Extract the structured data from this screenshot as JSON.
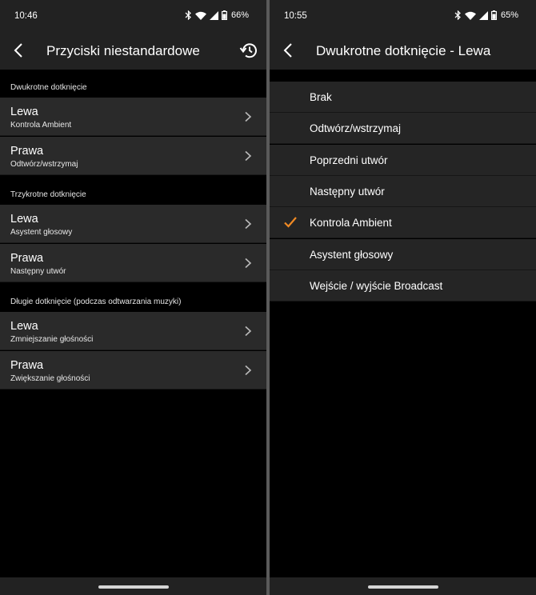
{
  "left": {
    "status": {
      "time": "10:46",
      "battery": "66%"
    },
    "title": "Przyciski niestandardowe",
    "sections": [
      {
        "header": "Dwukrotne dotknięcie",
        "items": [
          {
            "label": "Lewa",
            "value": "Kontrola Ambient"
          },
          {
            "label": "Prawa",
            "value": "Odtwórz/wstrzymaj"
          }
        ]
      },
      {
        "header": "Trzykrotne dotknięcie",
        "items": [
          {
            "label": "Lewa",
            "value": "Asystent głosowy"
          },
          {
            "label": "Prawa",
            "value": "Następny utwór"
          }
        ]
      },
      {
        "header": "Długie dotknięcie (podczas odtwarzania muzyki)",
        "items": [
          {
            "label": "Lewa",
            "value": "Zmniejszanie głośności"
          },
          {
            "label": "Prawa",
            "value": "Zwiększanie głośności"
          }
        ]
      }
    ]
  },
  "right": {
    "status": {
      "time": "10:55",
      "battery": "65%"
    },
    "title": "Dwukrotne dotknięcie - Lewa",
    "options": [
      "Brak",
      "Odtwórz/wstrzymaj",
      "Poprzedni utwór",
      "Następny utwór",
      "Kontrola Ambient",
      "Asystent głosowy",
      "Wejście / wyjście Broadcast"
    ],
    "selected_index": 4
  },
  "colors": {
    "accent": "#f08a24",
    "surface": "#2a2a2a",
    "bar": "#222222"
  },
  "icons": [
    "back-arrow-icon",
    "reset-icon",
    "chevron-right-icon",
    "checkmark-icon",
    "bluetooth-icon",
    "wifi-icon",
    "signal-icon",
    "battery-icon"
  ]
}
